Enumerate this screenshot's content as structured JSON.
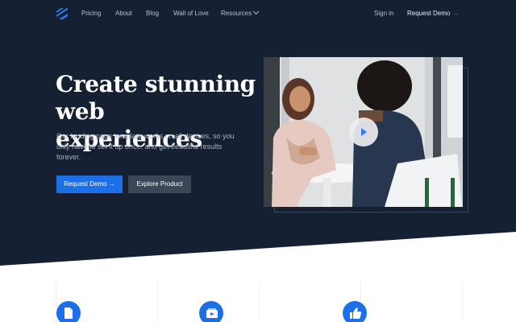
{
  "nav": {
    "logo_icon": "stripes-logo-icon",
    "links": [
      "Pricing",
      "About",
      "Blog",
      "Wall of Love",
      "Resources"
    ],
    "sign_in": "Sign in",
    "request_demo": "Request Demo",
    "arrow": "→"
  },
  "hero": {
    "headline": "Create stunning web experiences",
    "subtext": "Our landing page template works on all devices, so you only have to set it up once, and get beautiful results forever.",
    "primary_button": "Request Demo",
    "primary_button_arrow": "→",
    "secondary_button": "Explore Product",
    "video_thumbnail": "two-women-talking-photo",
    "play_icon": "play-icon"
  },
  "features": {
    "icons": [
      "document-icon",
      "media-icon",
      "thumbs-up-icon"
    ]
  },
  "colors": {
    "hero_bg": "#152033",
    "accent": "#1d6fe8",
    "secondary_button_bg": "#3b4656"
  }
}
